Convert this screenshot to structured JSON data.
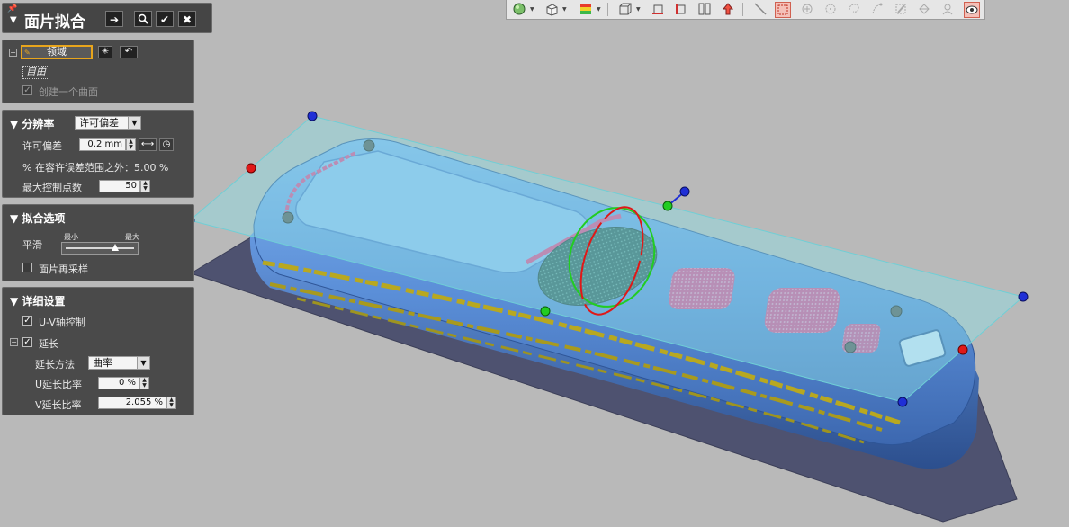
{
  "dialog": {
    "title": "面片拟合",
    "buttons": {
      "next": "➔",
      "preview": "🔍",
      "ok": "✔",
      "cancel": "✖"
    }
  },
  "region": {
    "button_label": "领域",
    "free_label": "自由",
    "create_one_surface": "创建一个曲面",
    "create_one_surface_checked": true
  },
  "resolution": {
    "header": "分辨率",
    "mode_value": "许可偏差",
    "tolerance_label": "许可偏差",
    "tolerance_value": "0.2 mm",
    "outside_range_text": "% 在容许误差范围之外：5.00 %",
    "max_ctrl_points_label": "最大控制点数",
    "max_ctrl_points_value": "50"
  },
  "fit_options": {
    "header": "拟合选项",
    "smooth_label": "平滑",
    "slider_min_label": "最小",
    "slider_max_label": "最大",
    "smooth_level_fraction": 0.72,
    "resample_label": "面片再采样",
    "resample_checked": false
  },
  "details": {
    "header": "详细设置",
    "uv_control_label": "U-V轴控制",
    "uv_control_checked": true,
    "extend_label": "延长",
    "extend_checked": true,
    "extend_method_label": "延长方法",
    "extend_method_value": "曲率",
    "u_ratio_label": "U延长比率",
    "u_ratio_value": "0 %",
    "v_ratio_label": "V延长比率",
    "v_ratio_value": "2.055 %"
  },
  "toolbar": {
    "icons": [
      "sphere-icon",
      "cube-icon",
      "color-map-icon",
      "box-wire-icon",
      "section-a-icon",
      "section-b-icon",
      "split-view-icon",
      "up-arrow-icon",
      "line-tool-icon",
      "rect-select-icon",
      "point-add-icon",
      "circle-icon",
      "lasso-icon",
      "paint-icon",
      "brush-icon",
      "fill-icon",
      "magnet-icon",
      "eye-icon"
    ]
  },
  "colors": {
    "panel_bg": "#4a4a4a",
    "viewport_bg": "#b9b9b9",
    "surface_fill": "#8ee0e6",
    "model_blue": "#5b8fd8",
    "handle_blue": "#1f2fd6",
    "handle_red": "#e01818",
    "handle_green": "#22cc22",
    "deviation_pink": "#e04a8a",
    "deviation_yellow": "#b8a820"
  }
}
